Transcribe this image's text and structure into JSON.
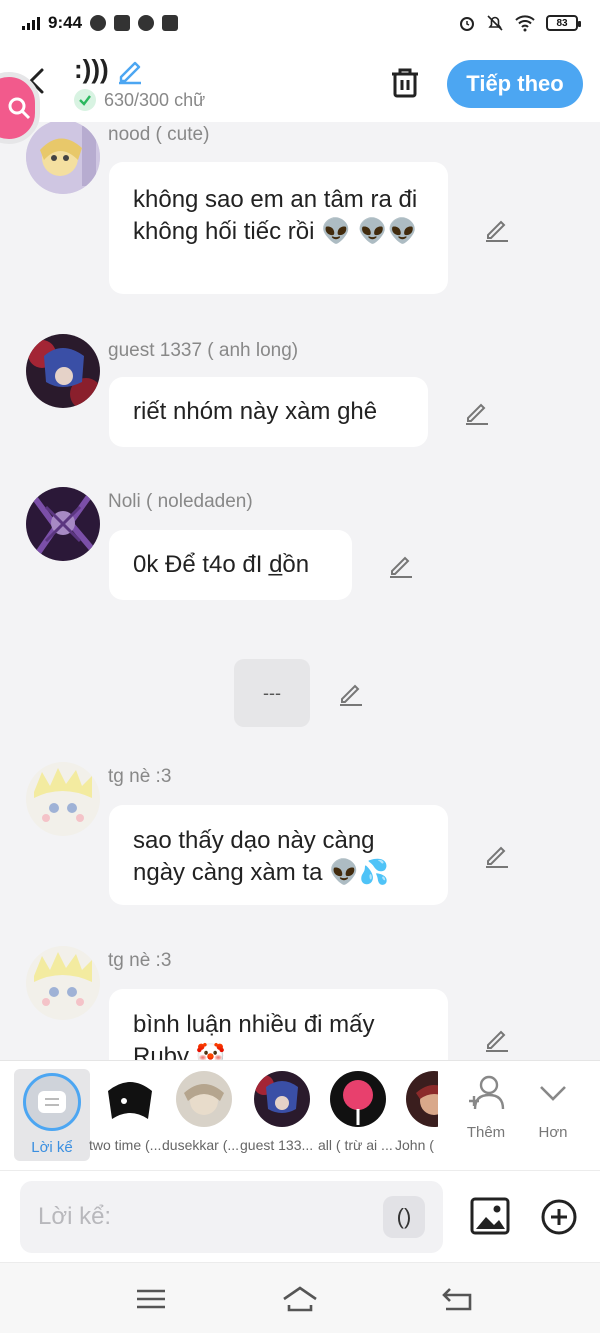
{
  "status_bar": {
    "time": "9:44",
    "battery": "83"
  },
  "header": {
    "title": ":)))",
    "char_count": "630/300 chữ",
    "next_label": "Tiếp theo"
  },
  "messages": [
    {
      "name": "nood ( cute)",
      "text": "không sao em an tâm ra đi không hối tiếc rồi 👽 👽👽"
    },
    {
      "name": "guest 1337 ( anh long)",
      "text": "riết nhóm này xàm ghê"
    },
    {
      "name": "Noli ( noledaden)",
      "text": "0k Để t4o đI d̲ồn"
    },
    {
      "name": "tg nè :3",
      "text": "sao thấy dạo này càng ngày càng xàm ta 👽💦"
    },
    {
      "name": "tg nè :3",
      "text": "bình luận nhiều đi mấy Ruby 🤡"
    }
  ],
  "separator": {
    "text": "---"
  },
  "characters": {
    "narrator": "Lời kể",
    "items": [
      "two time (...",
      "dusekkar (...",
      "guest 133...",
      "all ( trừ ai ...",
      "John ("
    ],
    "add_label": "Thêm",
    "more_label": "Hơn"
  },
  "input": {
    "placeholder": "Lời kể:",
    "paren_label": "()"
  },
  "colors": {
    "accent": "#4ca6f2",
    "fab": "#f25a8c",
    "background": "#f3f3f5"
  }
}
